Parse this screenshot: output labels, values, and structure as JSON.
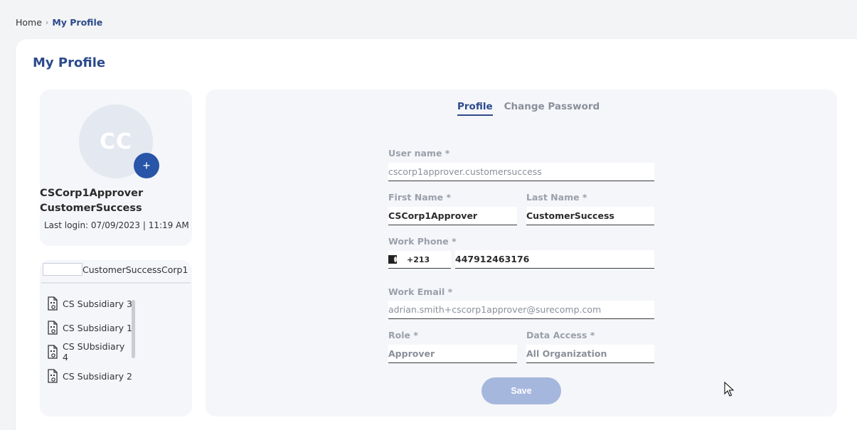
{
  "breadcrumb": {
    "home": "Home",
    "separator": "›",
    "current": "My Profile"
  },
  "page_title": "My Profile",
  "profile": {
    "avatar_initials": "CC",
    "avatar_add_icon": "+",
    "name_line1": "CSCorp1Approver",
    "name_line2": "CustomerSuccess",
    "last_login": "Last login: 07/09/2023 | 11:19 AM"
  },
  "organization": {
    "name": "CustomerSuccessCorp1",
    "subsidiaries": [
      {
        "label": "CS Subsidiary 3"
      },
      {
        "label": "CS Subsidiary 1"
      },
      {
        "label": "CS SUbsidiary 4"
      },
      {
        "label": "CS Subsidiary 2"
      }
    ]
  },
  "tabs": {
    "profile": "Profile",
    "change_password": "Change Password"
  },
  "form": {
    "username_label": "User name *",
    "username_value": "cscorp1approver.customersuccess",
    "firstname_label": "First Name *",
    "firstname_value": "CSCorp1Approver",
    "lastname_label": "Last Name *",
    "lastname_value": "CustomerSuccess",
    "workphone_label": "Work Phone *",
    "phone_code": "+213",
    "phone_number": "447912463176",
    "workemail_label": "Work Email *",
    "workemail_value": "adrian.smith+cscorp1approver@surecomp.com",
    "role_label": "Role *",
    "role_value": "Approver",
    "dataaccess_label": "Data Access *",
    "dataaccess_value": "All Organization",
    "save_label": "Save"
  },
  "icons": {
    "avatar_add": "plus-icon",
    "subsidiary": "building-document-icon",
    "flag": "algeria-flag-icon",
    "cursor": "mouse-pointer-icon"
  },
  "colors": {
    "accent": "#2c4a8c",
    "button_disabled": "#a6b7de",
    "panel_bg": "#f5f6fa"
  }
}
